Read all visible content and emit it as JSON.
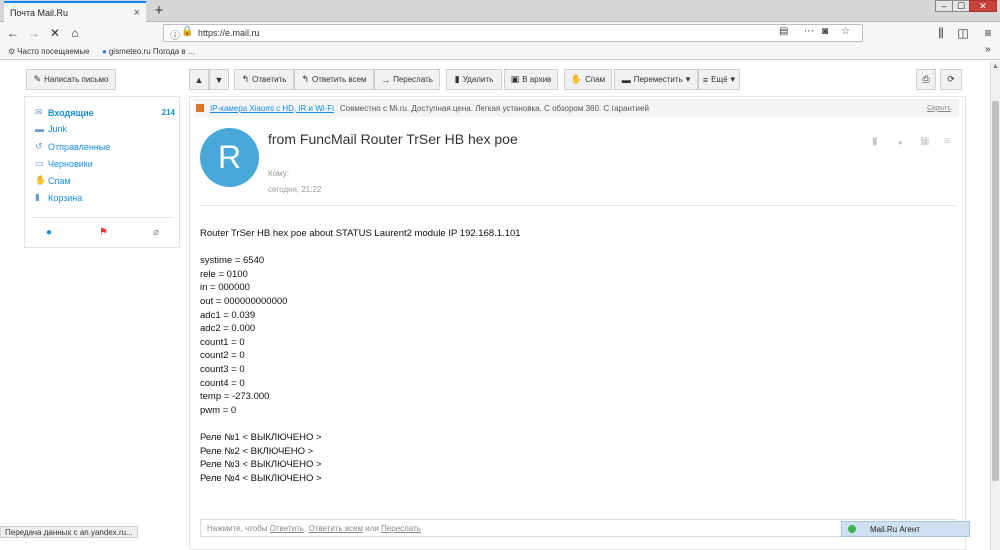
{
  "browser": {
    "tab_title": "Почта Mail.Ru",
    "tab_close": "×",
    "new_tab": "+",
    "win_min": "–",
    "win_max": "☐",
    "win_close": "✕",
    "url": "https://e.mail.ru",
    "bookmarks": [
      {
        "label": "Часто посещаемые"
      },
      {
        "label": "gismeteo.ru Погода в ..."
      }
    ],
    "more_bookmarks": "»"
  },
  "toolbar": {
    "compose": "Написать письмо",
    "reply": "Ответить",
    "reply_all": "Ответить всем",
    "forward": "Переслать",
    "delete": "Удалить",
    "archive": "В архив",
    "spam": "Спам",
    "move": "Переместить",
    "more": "Ещё"
  },
  "folders": [
    {
      "label": "Входящие",
      "count": "214"
    },
    {
      "label": "Junk"
    },
    {
      "label": "Отправленные"
    },
    {
      "label": "Черновики"
    },
    {
      "label": "Спам"
    },
    {
      "label": "Корзина"
    }
  ],
  "ad": {
    "link": "IP-камера Xiaomi с HD, IR и Wi-Fi",
    "text": "Совместно с Mi.ru. Доступная цена. Легкая установка. С обзором 360. С гарантией",
    "hide": "Скрыть"
  },
  "message": {
    "avatar_letter": "R",
    "subject": "from FuncMail Router TrSer HB hex poe",
    "to_label": "Кому:",
    "date": "сегодня, 21:22",
    "lines": [
      "Router TrSer HB hex poe about STATUS Laurent2 module IP 192.168.1.101",
      "",
      "systime = 6540",
      "rele = 0100",
      "in = 000000",
      "out = 000000000000",
      "adc1 = 0.039",
      "adc2 = 0.000",
      "count1 = 0",
      "count2 = 0",
      "count3 = 0",
      "count4 = 0",
      "temp = -273.000",
      "pwm = 0",
      "",
      "Реле №1 < ВЫКЛЮЧЕНО >",
      "Реле №2 < ВКЛЮЧЕНО >",
      "Реле №3 < ВЫКЛЮЧЕНО >",
      "Реле №4 < ВЫКЛЮЧЕНО >"
    ]
  },
  "reply_box": {
    "prefix": "Нажмите, чтобы",
    "reply": "Ответить",
    "reply_all": "Ответить всем",
    "or": "или",
    "forward": "Переслать"
  },
  "status": "Передача данных с an.yandex.ru...",
  "agent": "Mail.Ru Агент",
  "colors": {
    "accent": "#168de2",
    "avatar": "#48a8d9",
    "tab_accent": "#0a84ff"
  }
}
